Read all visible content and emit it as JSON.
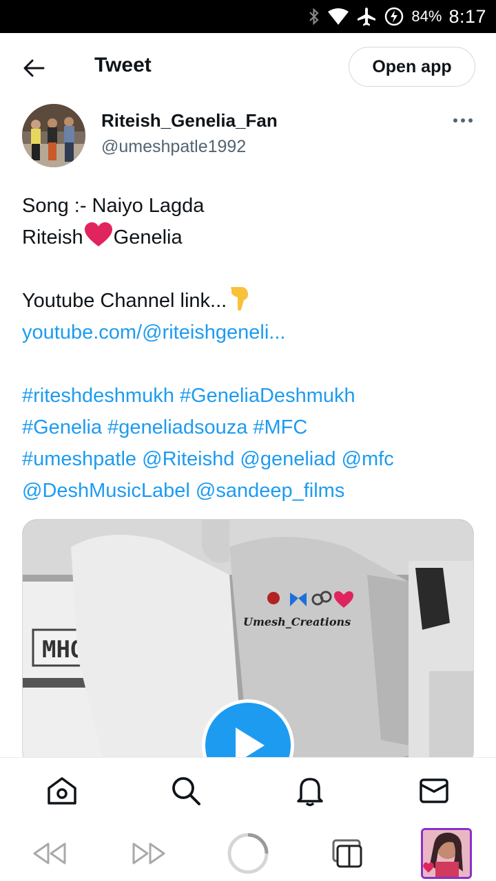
{
  "status_bar": {
    "battery": "84%",
    "time": "8:17"
  },
  "header": {
    "title": "Tweet",
    "open_app_label": "Open app"
  },
  "author": {
    "name": "Riteish_Genelia_Fan",
    "handle": "@umeshpatle1992"
  },
  "tweet": {
    "song_line": "Song :- Naiyo Lagda",
    "name_left": "Riteish",
    "name_right": "Genelia",
    "channel_line": "Youtube Channel link...",
    "youtube_link": "youtube.com/@riteishgeneli...",
    "hashtags": [
      {
        "text": "#riteshdeshmukh",
        "space": " "
      },
      {
        "text": "#GeneliaDeshmukh"
      }
    ],
    "tags_line1": [
      "#riteshdeshmukh",
      "#GeneliaDeshmukh"
    ],
    "tags_line2": [
      "#Genelia",
      "#geneliadsouza",
      "#MFC"
    ],
    "tags_line3": [
      "#umeshpatle",
      "@Riteishd",
      "@geneliad",
      "@mfc"
    ],
    "tags_line4": [
      "@DeshMusicLabel",
      "@sandeep_films"
    ]
  },
  "media": {
    "watermark": "Umesh_Creations",
    "plate_text": "MHO"
  },
  "tab_bar": {
    "items": [
      "home-icon",
      "search-icon",
      "notifications-icon",
      "messages-icon"
    ]
  },
  "browser_bar": {
    "items": [
      "back-icon",
      "forward-icon",
      "reload-icon",
      "tabs-icon",
      "profile-thumbnail"
    ]
  },
  "colors": {
    "link": "#1d9bf0",
    "accent": "#1d9bf0",
    "heart": "#e0245e",
    "profile_border": "#8b2fc9"
  }
}
